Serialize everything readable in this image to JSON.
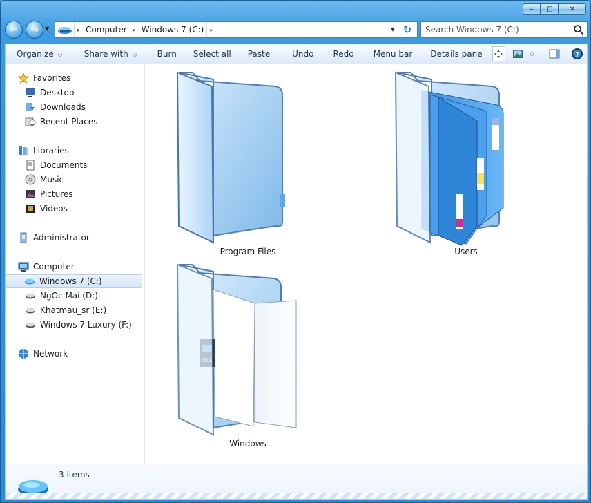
{
  "window": {
    "caption_buttons": [
      "minimize",
      "maximize",
      "close"
    ]
  },
  "navigation": {
    "breadcrumb": [
      "Computer",
      "Windows 7 (C:)"
    ],
    "search_placeholder": "Search Windows 7 (C:)"
  },
  "toolbar": {
    "items": [
      "Organize",
      "Share with",
      "Burn",
      "Select all",
      "Paste",
      "Undo",
      "Redo",
      "Menu bar",
      "Details pane"
    ]
  },
  "sidebar": {
    "favorites": {
      "label": "Favorites",
      "items": [
        "Desktop",
        "Downloads",
        "Recent Places"
      ]
    },
    "libraries": {
      "label": "Libraries",
      "items": [
        "Documents",
        "Music",
        "Pictures",
        "Videos"
      ]
    },
    "administrator": "Administrator",
    "computer": {
      "label": "Computer",
      "items": [
        "Windows 7 (C:)",
        "NgOc Mai (D:)",
        "Khatmau_sr (E:)",
        "Windows 7 Luxury (F:)"
      ],
      "selected": "Windows 7 (C:)"
    },
    "network": "Network"
  },
  "content": {
    "folders": [
      {
        "name": "Program Files"
      },
      {
        "name": "Users"
      },
      {
        "name": "Windows"
      }
    ]
  },
  "statusbar": {
    "count_text": "3 items"
  },
  "colors": {
    "frame": "#3d9ae0",
    "toolbar_text": "#1e3552",
    "folder_blue": "#5aa9ea"
  }
}
